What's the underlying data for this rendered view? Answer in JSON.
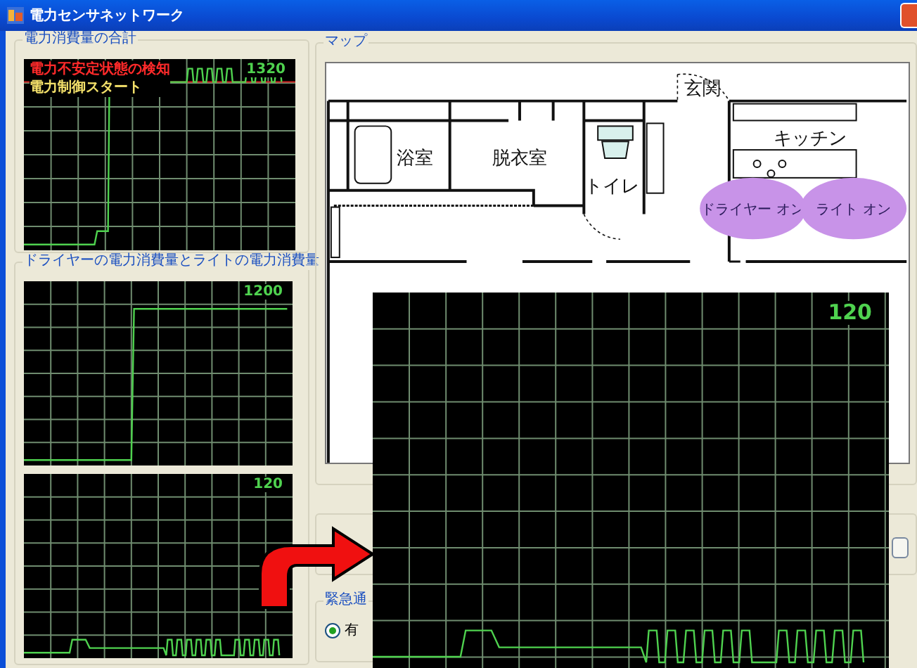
{
  "window": {
    "title": "電力センサネットワーク"
  },
  "total_group": {
    "title": "電力消費量の合計",
    "scope": {
      "reading": "1320",
      "kind": "total",
      "notes": [
        {
          "text": "電力不安定状態の検知",
          "kind": "alert"
        },
        {
          "text": "電力制御スタート",
          "kind": "control"
        }
      ]
    }
  },
  "device_group": {
    "title": "ドライヤーの電力消費量とライトの電力消費量",
    "scopes": [
      {
        "reading": "1200",
        "kind": "dryer"
      },
      {
        "reading": "120",
        "kind": "light"
      }
    ]
  },
  "map_group": {
    "title": "マップ",
    "rooms": [
      "玄関",
      "浴室",
      "脱衣室",
      "トイレ",
      "キッチン"
    ],
    "devices": [
      {
        "label": "ドライヤー オン",
        "on": true
      },
      {
        "label": "ライト オン",
        "on": true
      }
    ]
  },
  "emergency_group": {
    "title": "緊急通",
    "options": [
      {
        "label": "有",
        "selected": true
      }
    ]
  },
  "zoom_view": {
    "reading": "120",
    "kind": "light"
  }
}
